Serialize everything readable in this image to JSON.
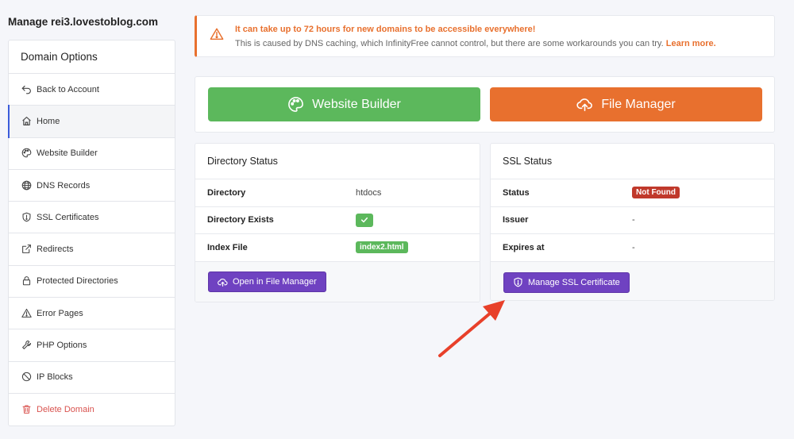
{
  "page": {
    "title": "Manage rei3.lovestoblog.com"
  },
  "sidebar": {
    "header": "Domain Options",
    "items": [
      {
        "label": "Back to Account",
        "icon": "back-arrow-icon"
      },
      {
        "label": "Home",
        "icon": "home-icon"
      },
      {
        "label": "Website Builder",
        "icon": "palette-icon"
      },
      {
        "label": "DNS Records",
        "icon": "globe-icon"
      },
      {
        "label": "SSL Certificates",
        "icon": "shield-icon"
      },
      {
        "label": "Redirects",
        "icon": "external-link-icon"
      },
      {
        "label": "Protected Directories",
        "icon": "lock-icon"
      },
      {
        "label": "Error Pages",
        "icon": "warning-icon"
      },
      {
        "label": "PHP Options",
        "icon": "wrench-icon"
      },
      {
        "label": "IP Blocks",
        "icon": "block-icon"
      },
      {
        "label": "Delete Domain",
        "icon": "trash-icon"
      }
    ]
  },
  "alert": {
    "title": "It can take up to 72 hours for new domains to be accessible everywhere!",
    "description": "This is caused by DNS caching, which InfinityFree cannot control, but there are some workarounds you can try.",
    "link": "Learn more."
  },
  "quick_actions": {
    "website_builder": "Website Builder",
    "file_manager": "File Manager"
  },
  "directory_status": {
    "title": "Directory Status",
    "directory_label": "Directory",
    "directory_value": "htdocs",
    "exists_label": "Directory Exists",
    "index_label": "Index File",
    "index_value": "index2.html",
    "button": "Open in File Manager"
  },
  "ssl_status": {
    "title": "SSL Status",
    "status_label": "Status",
    "status_value": "Not Found",
    "issuer_label": "Issuer",
    "issuer_value": "-",
    "expires_label": "Expires at",
    "expires_value": "-",
    "button": "Manage SSL Certificate"
  },
  "colors": {
    "accent_orange": "#e8702e",
    "success_green": "#5cb85c",
    "purple": "#6f42c1",
    "danger_red": "#c0392b",
    "arrow_red": "#e8402a"
  }
}
